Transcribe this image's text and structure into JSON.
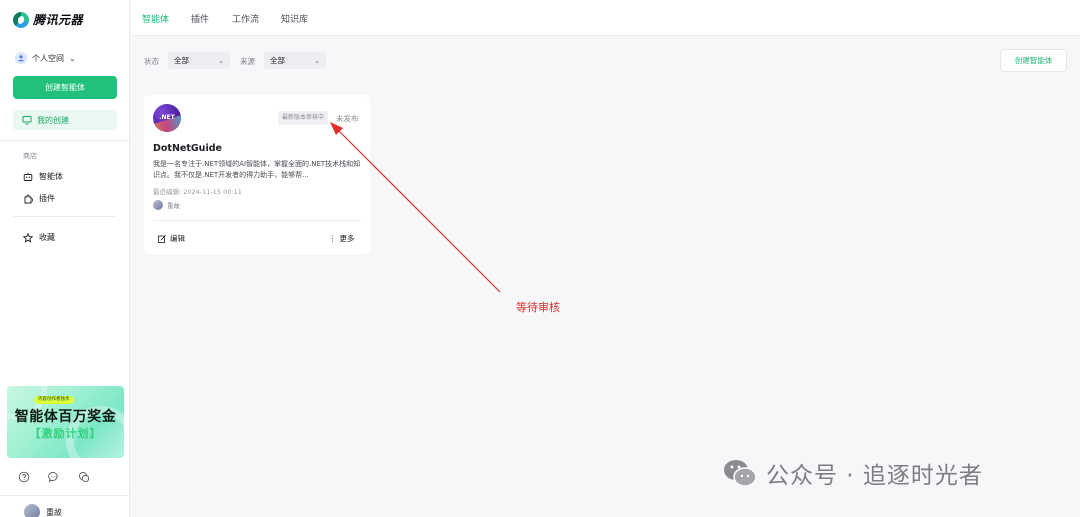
{
  "app": {
    "logo_text": "腾讯元器"
  },
  "sidebar": {
    "space_label": "个人空间",
    "create_button": "创建智能体",
    "my_creations": "我的创建",
    "store_title": "商店",
    "nav": [
      {
        "label": "智能体",
        "icon": "robot-icon"
      },
      {
        "label": "插件",
        "icon": "plugin-icon"
      },
      {
        "label": "收藏",
        "icon": "star-icon"
      }
    ],
    "banner": {
      "pill": "内容创作者独享",
      "title": "智能体百万奖金",
      "subtitle": "【激励计划】"
    },
    "bottom_icons": [
      "help-icon",
      "chat-icon",
      "community-icon"
    ],
    "user_name": "重故"
  },
  "topnav": {
    "tabs": [
      {
        "label": "智能体",
        "active": true
      },
      {
        "label": "插件",
        "active": false
      },
      {
        "label": "工作流",
        "active": false
      },
      {
        "label": "知识库",
        "active": false
      }
    ]
  },
  "filters": {
    "status_label": "状态",
    "status_value": "全部",
    "source_label": "来源",
    "source_value": "全部",
    "create_button": "创建智能体"
  },
  "card": {
    "avatar_text": ".NET",
    "review_badge": "最新版本审核中",
    "publish_status": "未发布",
    "name": "DotNetGuide",
    "description": "我是一名专注于.NET领域的AI智能体，掌握全面的.NET技术栈和知识点。我不仅是.NET开发者的得力助手，能够帮...",
    "last_edited": "最近编辑: 2024-11-15 00:11",
    "owner": "重故",
    "edit_label": "编辑",
    "more_label": "更多"
  },
  "annotation": {
    "text": "等待审核",
    "color": "#e0302b"
  },
  "watermark": {
    "text": "公众号 · 追逐时光者"
  },
  "colors": {
    "accent": "#22c17b",
    "accent_text": "#22b573"
  }
}
